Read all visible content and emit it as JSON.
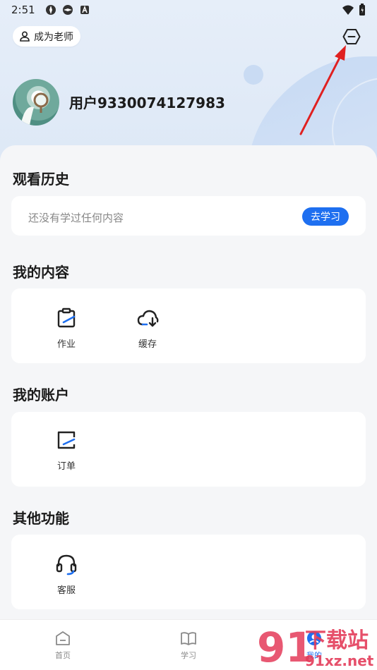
{
  "status_bar": {
    "time": "2:51"
  },
  "header": {
    "teacher_button_label": "成为老师",
    "username": "用户9330074127983"
  },
  "history": {
    "title": "观看历史",
    "empty_text": "还没有学过任何内容",
    "go_study_label": "去学习"
  },
  "my_content": {
    "title": "我的内容",
    "items": [
      {
        "label": "作业",
        "icon": "homework-icon"
      },
      {
        "label": "缓存",
        "icon": "cloud-download-icon"
      }
    ]
  },
  "my_account": {
    "title": "我的账户",
    "items": [
      {
        "label": "订单",
        "icon": "order-icon"
      }
    ]
  },
  "other": {
    "title": "其他功能",
    "items": [
      {
        "label": "客服",
        "icon": "headset-icon"
      }
    ]
  },
  "tab_bar": {
    "tabs": [
      {
        "label": "首页",
        "icon": "home-icon"
      },
      {
        "label": "学习",
        "icon": "book-icon"
      },
      {
        "label": "我的",
        "icon": "profile-icon",
        "active": true
      }
    ]
  },
  "watermark": {
    "brand": "下载站",
    "domain": "91xz.net"
  },
  "colors": {
    "accent": "#1e6ff0",
    "header_bg": "#e2ebf8",
    "annotation_arrow": "#e02020"
  }
}
